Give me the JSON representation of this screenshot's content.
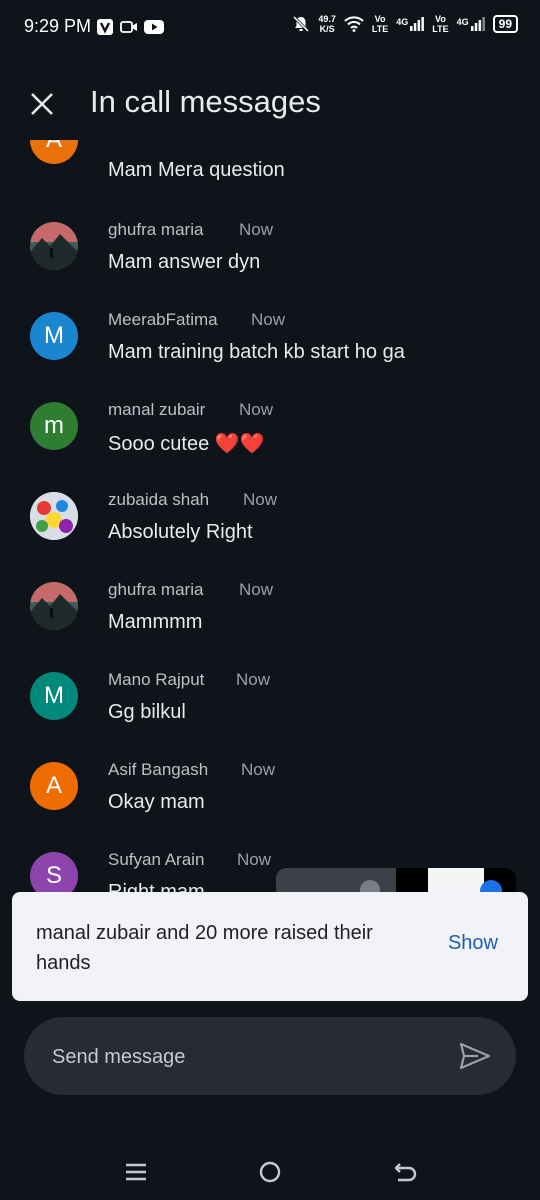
{
  "status_bar": {
    "time": "9:29 PM",
    "net_speed_value": "49.7",
    "net_speed_unit": "K/S",
    "sim1_tech": "4G",
    "sim1_volte_top": "Vo",
    "sim1_volte_bottom": "LTE",
    "sim2_tech": "4G",
    "sim2_volte_top": "Vo",
    "sim2_volte_bottom": "LTE",
    "battery": "99",
    "icons": [
      "v-app-icon",
      "video-call-icon",
      "youtube-icon",
      "mute-bell-icon",
      "wifi-icon",
      "signal-icon"
    ]
  },
  "header": {
    "title": "In call messages",
    "close_icon": "close-icon"
  },
  "messages": [
    {
      "sender": "",
      "time": "",
      "text": "Mam Mera question",
      "avatar_letter": "A",
      "avatar_color": "#e8710a"
    },
    {
      "sender": "ghufra maria",
      "time": "Now",
      "text": "Mam answer dyn",
      "avatar_letter": "",
      "avatar_color": "#4a5a5a"
    },
    {
      "sender": "MeerabFatima",
      "time": "Now",
      "text": "Mam training batch kb start ho ga",
      "avatar_letter": "M",
      "avatar_color": "#1a86d0"
    },
    {
      "sender": "manal zubair",
      "time": "Now",
      "text": "Sooo cutee ❤️❤️",
      "avatar_letter": "m",
      "avatar_color": "#2e7d32"
    },
    {
      "sender": "zubaida shah",
      "time": "Now",
      "text": "Absolutely Right",
      "avatar_letter": "",
      "avatar_color": "#d8dde6"
    },
    {
      "sender": "ghufra maria",
      "time": "Now",
      "text": "Mammmm",
      "avatar_letter": "",
      "avatar_color": "#4a5a5a"
    },
    {
      "sender": "Mano Rajput",
      "time": "Now",
      "text": "Gg bilkul",
      "avatar_letter": "M",
      "avatar_color": "#00897b"
    },
    {
      "sender": "Asif Bangash",
      "time": "Now",
      "text": "Okay mam",
      "avatar_letter": "A",
      "avatar_color": "#ef6c00"
    },
    {
      "sender": "Sufyan Arain",
      "time": "Now",
      "text": "Right mam",
      "avatar_letter": "S",
      "avatar_color": "#8e44ad"
    }
  ],
  "banner": {
    "text": "manal zubair and 20 more raised their hands",
    "action": "Show"
  },
  "composer": {
    "placeholder": "Send message",
    "send_icon": "send-icon"
  },
  "nav": {
    "icons": [
      "recents-icon",
      "home-icon",
      "back-icon"
    ]
  }
}
